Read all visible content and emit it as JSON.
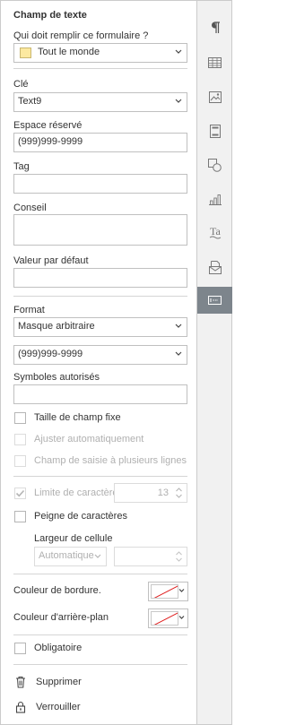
{
  "panel": {
    "title": "Champ de texte",
    "fill_label": "Qui doit remplir ce formulaire ?",
    "fill_value": "Tout le monde",
    "fill_color": "#fce9a0",
    "key_label": "Clé",
    "key_value": "Text9",
    "placeholder_label": "Espace réservé",
    "placeholder_value": "(999)999-9999",
    "tag_label": "Tag",
    "tag_value": "",
    "tip_label": "Conseil",
    "tip_value": "",
    "default_label": "Valeur par défaut",
    "default_value": "",
    "format_label": "Format",
    "format_value": "Masque arbitraire",
    "mask_value": "(999)999-9999",
    "allowed_label": "Symboles autorisés",
    "allowed_value": "",
    "fixed_size_label": "Taille de champ fixe",
    "autofit_label": "Ajuster automatiquement",
    "multiline_label": "Champ de saisie à plusieurs lignes",
    "char_limit_label": "Limite de caractères",
    "char_limit_value": "13",
    "comb_label": "Peigne de caractères",
    "cell_width_label": "Largeur de cellule",
    "cell_width_value": "Automatique",
    "border_color_label": "Couleur de bordure.",
    "background_color_label": "Couleur d'arrière-plan",
    "required_label": "Obligatoire",
    "delete_label": "Supprimer",
    "lock_label": "Verrouiller"
  },
  "rail": {
    "items": [
      "paragraph-icon",
      "table-icon",
      "image-icon",
      "header-footer-icon",
      "shape-icon",
      "chart-icon",
      "text-art-icon",
      "mail-merge-icon",
      "form-field-icon"
    ],
    "active": "form-field-icon",
    "active_color": "#7d858c"
  }
}
